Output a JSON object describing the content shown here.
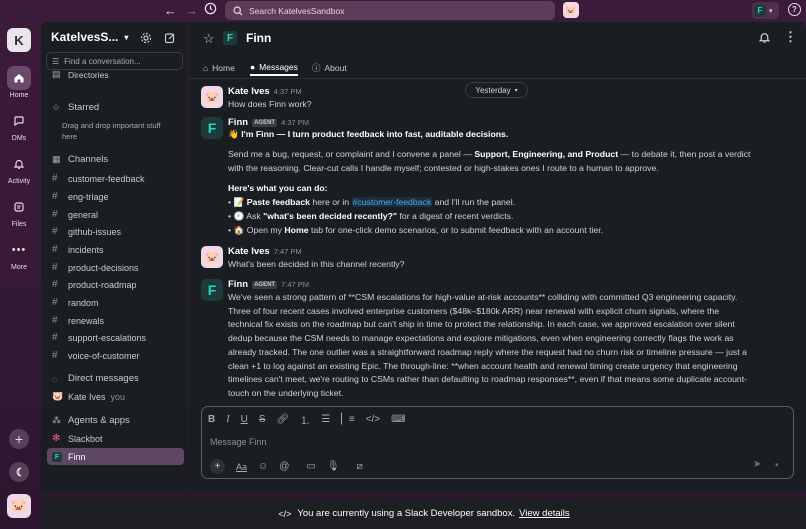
{
  "topbar": {
    "search_placeholder": "Search KatelvesSandbox"
  },
  "rail": {
    "workspace_initial": "K",
    "items": [
      {
        "label": "Home",
        "icon": "home-icon"
      },
      {
        "label": "DMs",
        "icon": "dms-icon"
      },
      {
        "label": "Activity",
        "icon": "bell-icon"
      },
      {
        "label": "Files",
        "icon": "files-icon"
      },
      {
        "label": "More",
        "icon": "more-icon"
      }
    ]
  },
  "sidebar": {
    "workspace_name": "KatelvesS...",
    "find_placeholder": "Find a conversation...",
    "directories": "Directories",
    "starred_title": "Starred",
    "starred_hint": "Drag and drop important stuff here",
    "channels_title": "Channels",
    "channels": [
      "customer-feedback",
      "eng-triage",
      "general",
      "github-issues",
      "incidents",
      "product-decisions",
      "product-roadmap",
      "random",
      "renewals",
      "support-escalations",
      "voice-of-customer"
    ],
    "dm_title": "Direct messages",
    "dm_user": "Kate Ives",
    "dm_you": "you",
    "apps_title": "Agents & apps",
    "apps": [
      "Slackbot",
      "Finn"
    ]
  },
  "channel": {
    "name": "Finn",
    "tabs": [
      "Home",
      "Messages",
      "About"
    ]
  },
  "date_pill": "Yesterday",
  "messages": [
    {
      "author": "Kate Ives",
      "time": "4:37 PM",
      "text": "How does Finn work?"
    },
    {
      "author": "Finn",
      "badge": "AGENT",
      "time": "4:37 PM",
      "intro": "I'm Finn — I turn product feedback into fast, auditable decisions.",
      "p1a": "Send me a bug, request, or complaint and I convene a panel — ",
      "p1b": "Support, Engineering, and Product",
      "p1c": " — to debate it, then post a verdict",
      "p1d": "with the reasoning. Clear-cut calls I handle myself; contested or high-stakes ones I route to a human to approve.",
      "heading": "Here's what you can do:",
      "b1a": "Paste feedback",
      "b1b": " here or in ",
      "b1link": "#customer-feedback",
      "b1c": " and I'll run the panel.",
      "b2a": "Ask ",
      "b2b": "\"what's been decided recently?\"",
      "b2c": " for a digest of recent verdicts.",
      "b3a": "Open my ",
      "b3b": "Home",
      "b3c": " tab for one-click demo scenarios, or to submit feedback with an account tier."
    },
    {
      "author": "Kate Ives",
      "time": "7:47 PM",
      "text": "What's been decided in this channel recently?"
    },
    {
      "author": "Finn",
      "badge": "AGENT",
      "time": "7:47 PM",
      "lines": [
        "We've seen a strong pattern of **CSM escalations for high-value at-risk accounts** colliding with committed Q3 engineering capacity.",
        "Three of four recent cases involved enterprise customers ($48k–$180k ARR) near renewal with explicit churn signals, where the",
        "technical fix exists on the roadmap but can't ship in time to protect the relationship. In each case, we approved escalation over silent",
        "dedup because the CSM needs to manage expectations and explore mitigations, even when engineering correctly flags the work as",
        "already tracked. The one outlier was a straightforward roadmap reply where the request had no churn risk or timeline pressure — just a",
        "clean +1 to log against an existing Epic. The through-line: **when account health and renewal timing create urgency that engineering",
        "timelines can't meet, we're routing to CSMs rather than defaulting to roadmap responses**, even if that means some duplicate account-",
        "touch on the underlying ticket."
      ]
    }
  ],
  "composer": {
    "placeholder": "Message Finn"
  },
  "banner": {
    "text": "You are currently using a Slack Developer sandbox.",
    "link": "View details"
  }
}
